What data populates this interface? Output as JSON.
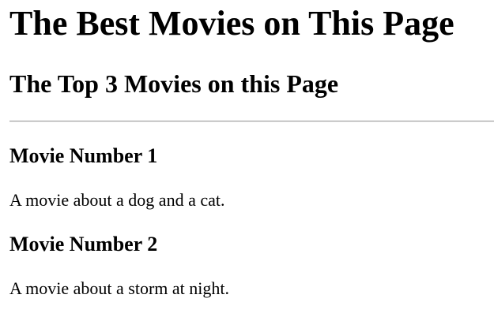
{
  "page": {
    "heading": "The Best Movies on This Page",
    "subheading": "The Top 3 Movies on this Page"
  },
  "movies": [
    {
      "title": "Movie Number 1",
      "description": "A movie about a dog and a cat."
    },
    {
      "title": "Movie Number 2",
      "description": "A movie about a storm at night."
    }
  ]
}
